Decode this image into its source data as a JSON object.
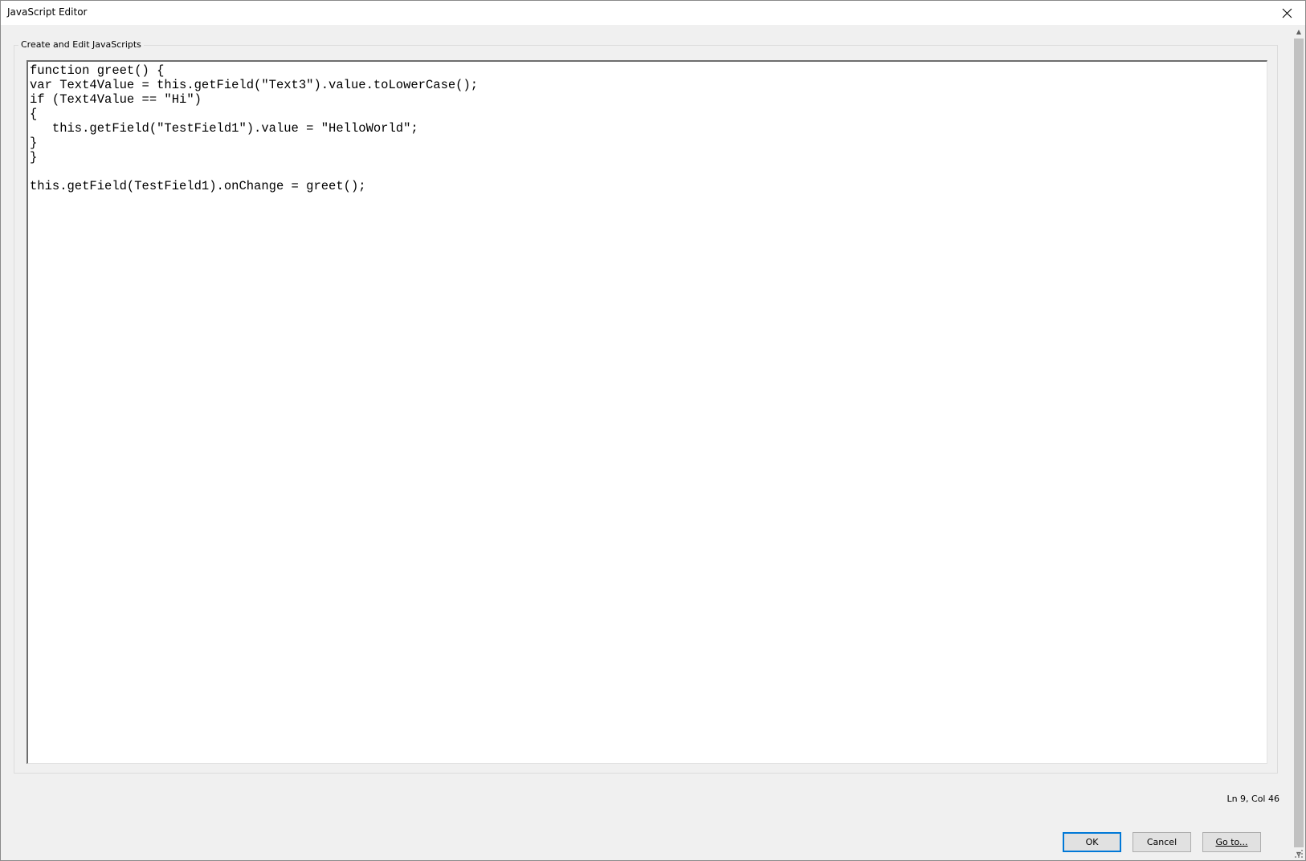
{
  "window": {
    "title": "JavaScript Editor",
    "close_icon": "close-icon"
  },
  "group": {
    "label": "Create and Edit JavaScripts"
  },
  "editor": {
    "lines": [
      "function greet() {",
      "var Text4Value = this.getField(\"Text3\").value.toLowerCase();",
      "if (Text4Value == \"Hi\")",
      "{",
      "   this.getField(\"TestField1\").value = \"HelloWorld\";",
      "}",
      "}",
      "",
      "this.getField(TestField1).onChange = greet();"
    ]
  },
  "status": {
    "cursor_position": "Ln 9, Col 46"
  },
  "buttons": {
    "ok_label": "OK",
    "cancel_label": "Cancel",
    "goto_label": "Go to..."
  },
  "colors": {
    "accent": "#0078d7",
    "background": "#f0f0f0"
  }
}
